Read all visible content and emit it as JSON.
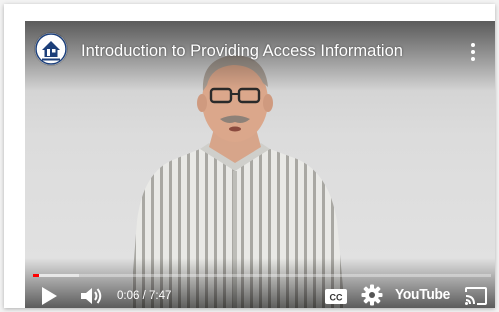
{
  "video": {
    "title": "Introduction to Providing Access Information",
    "channel_logo_icon": "house-logo-icon"
  },
  "controls": {
    "current_time": "0:06",
    "time_separator": " / ",
    "duration": "7:47",
    "played_fraction": 0.013,
    "buffered_fraction": 0.1,
    "brand_label": "YouTube"
  },
  "icons": {
    "more": "kebab-menu-icon",
    "play": "play-icon",
    "volume": "volume-icon",
    "captions": "closed-captions-icon",
    "settings": "gear-icon",
    "cast": "cast-icon"
  },
  "colors": {
    "progress_played": "#ff0000",
    "overlay_text": "#ffffff"
  }
}
